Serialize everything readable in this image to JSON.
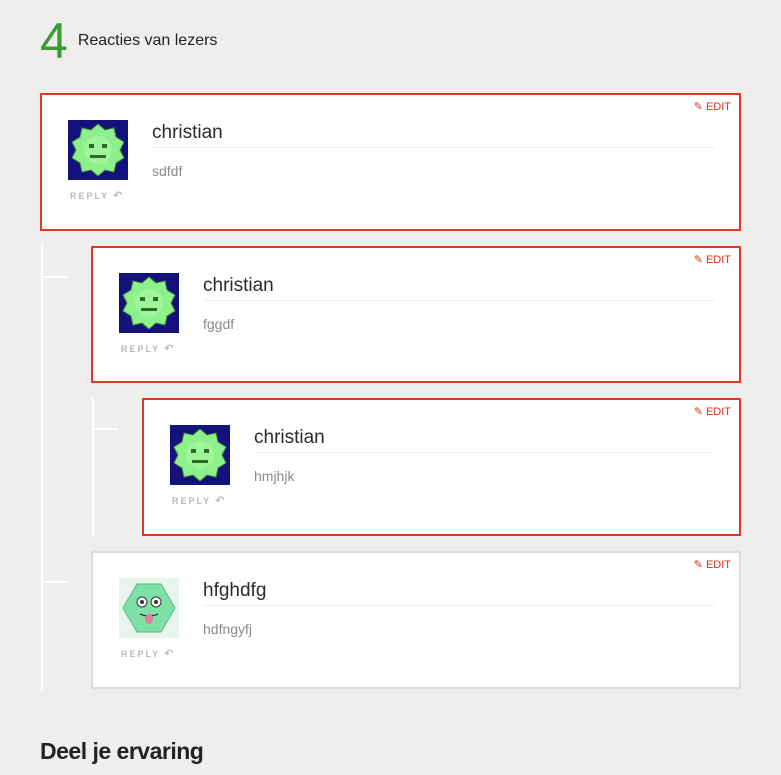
{
  "comments_header": {
    "count": "4",
    "label": "Reacties van lezers"
  },
  "comments": [
    {
      "author": "christian",
      "text": "sdfdf",
      "reply_label": "REPLY",
      "edit_label": "EDIT",
      "avatar": "green-gear-avatar"
    },
    {
      "author": "christian",
      "text": "fggdf",
      "reply_label": "REPLY",
      "edit_label": "EDIT",
      "avatar": "green-gear-avatar"
    },
    {
      "author": "christian",
      "text": "hmjhjk",
      "reply_label": "REPLY",
      "edit_label": "EDIT",
      "avatar": "green-gear-avatar"
    },
    {
      "author": "hfghdfg",
      "text": "hdfngyfj",
      "reply_label": "REPLY",
      "edit_label": "EDIT",
      "avatar": "green-hexagon-face-avatar"
    }
  ],
  "section": {
    "title": "Deel je ervaring"
  },
  "colors": {
    "accent_green": "#3a9b35",
    "edit_red": "#d8301a",
    "border_red": "#e0391f"
  },
  "icons": {
    "reply": "reply-arrow-icon",
    "edit": "edit-pencil-icon"
  }
}
